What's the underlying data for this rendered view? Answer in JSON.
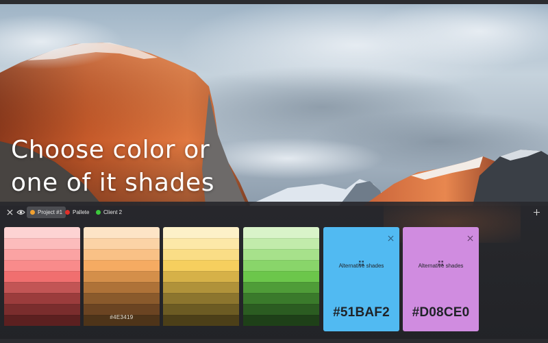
{
  "hero": {
    "line1": "Choose color or",
    "line2": "one of it shades"
  },
  "toolbar": {
    "close_icon": "close-icon",
    "eye_icon": "eye-icon",
    "add_icon": "plus-icon",
    "tags": [
      {
        "label": "Project #1",
        "color": "#f0a030",
        "active": true
      },
      {
        "label": "Pallete",
        "color": "#e0302a",
        "active": false
      },
      {
        "label": "Client 2",
        "color": "#3cc83c",
        "active": false
      }
    ]
  },
  "swatches": [
    {
      "name": "red",
      "shades": [
        "#fdd3d3",
        "#fcbcbc",
        "#fba3a3",
        "#f98b8b",
        "#f06f6f",
        "#c25555",
        "#9b3c3c",
        "#7a2d2d",
        "#5c2020"
      ],
      "hex_label": ""
    },
    {
      "name": "orange",
      "shades": [
        "#fde4c6",
        "#fbd3a6",
        "#f9c186",
        "#f5ab62",
        "#d48f4a",
        "#ae7238",
        "#8a5a2c",
        "#6b4422",
        "#4e3419"
      ],
      "hex_label": "#4E3419"
    },
    {
      "name": "yellow",
      "shades": [
        "#fdf1c8",
        "#fce8a8",
        "#fadd86",
        "#f6cf5e",
        "#d6b148",
        "#b0923a",
        "#8c752e",
        "#6c5b23",
        "#4c3f18"
      ],
      "hex_label": ""
    },
    {
      "name": "green",
      "shades": [
        "#d9f3c9",
        "#c2ebab",
        "#a7e18b",
        "#89d56a",
        "#6cc64b",
        "#4f9c38",
        "#3a7a2b",
        "#2b5c21",
        "#1e4018"
      ],
      "hex_label": ""
    }
  ],
  "alternatives": [
    {
      "label": "Alternative shades",
      "hex": "#51BAF2",
      "color": "#51baf2"
    },
    {
      "label": "Alternative shades",
      "hex": "#D08CE0",
      "color": "#d08ce0"
    }
  ]
}
